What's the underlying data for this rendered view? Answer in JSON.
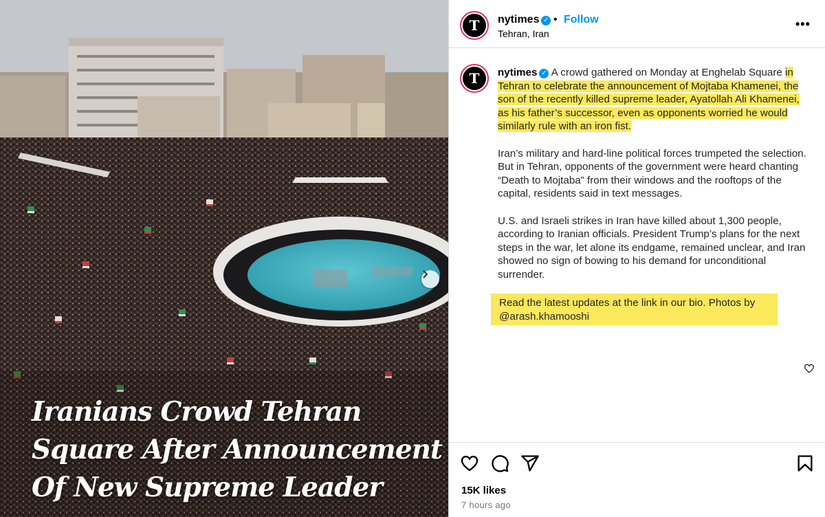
{
  "post": {
    "headline_lines": [
      "Iranians Crowd Tehran",
      "Square After Announcement",
      "Of New Supreme Leader"
    ]
  },
  "header": {
    "username": "nytimes",
    "follow_label": "Follow",
    "separator": "•",
    "location": "Tehran, Iran",
    "more_label": "•••",
    "avatar_letter": "T"
  },
  "caption": {
    "username": "nytimes",
    "p1_plain": "A crowd gathered on Monday at Enghelab Square ",
    "p1_highlight": "in Tehran to celebrate the announcement of Mojtaba Khamenei, the son of the recently killed supreme leader, Ayatollah Ali Khamenei, as his father’s successor, even as opponents worried he would similarly rule with an iron fist.",
    "p2": "Iran’s military and hard-line political forces trumpeted the selection. But in Tehran, opponents of the government were heard chanting “Death to Mojtaba” from their windows and the rooftops of the capital, residents said in text messages.",
    "p3": "U.S. and Israeli strikes in Iran have killed about 1,300 people, according to Iranian officials. President Trump’s plans for the next steps in the war, let alone its endgame, remained unclear, and Iran showed no sign of bowing to his demand for unconditional surrender.",
    "p4": "Read the latest updates at the link in our bio. Photos by @arash.khamooshi"
  },
  "footer": {
    "likes": "15K likes",
    "time": "7 hours ago"
  },
  "colors": {
    "highlight": "#fbe85b",
    "follow": "#0095f6",
    "verified": "#0095f6"
  }
}
